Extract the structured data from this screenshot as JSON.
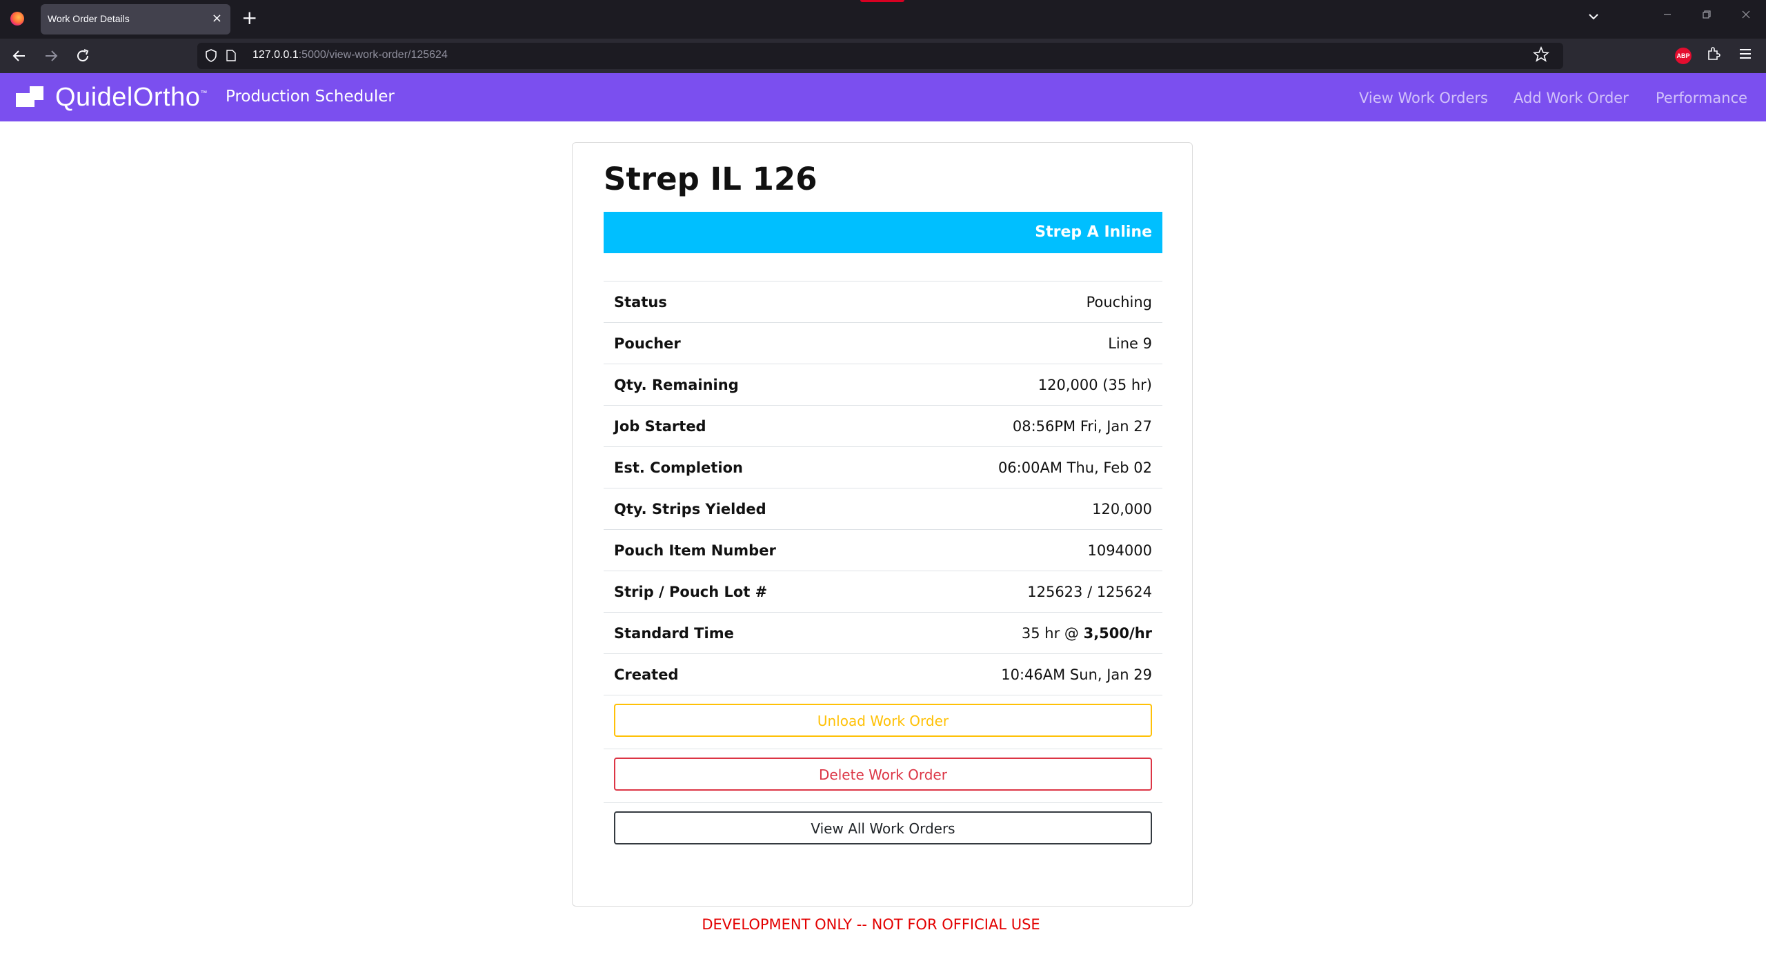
{
  "browser": {
    "tab_title": "Work Order Details",
    "tab_close": "×",
    "new_tab": "+",
    "url_host": "127.0.0.1",
    "url_path": ":5000/view-work-order/125624",
    "abp_label": "ABP"
  },
  "app": {
    "brand": "QuidelOrtho",
    "brand_tm": "™",
    "title": "Production Scheduler",
    "nav": [
      "View Work Orders",
      "Add Work Order",
      "Performance"
    ],
    "accent_color": "#7b4fef"
  },
  "work_order": {
    "title": "Strep IL 126",
    "product": "Strep A Inline",
    "product_color": "#00bfff",
    "details": [
      {
        "label": "Status",
        "value": "Pouching"
      },
      {
        "label": "Poucher",
        "value": "Line 9"
      },
      {
        "label": "Qty. Remaining",
        "value": "120,000 (35 hr)"
      },
      {
        "label": "Job Started",
        "value": "08:56PM Fri, Jan 27"
      },
      {
        "label": "Est. Completion",
        "value": "06:00AM Thu, Feb 02"
      },
      {
        "label": "Qty. Strips Yielded",
        "value": "120,000"
      },
      {
        "label": "Pouch Item Number",
        "value": "1094000"
      },
      {
        "label": "Strip / Pouch Lot #",
        "value": "125623 / 125624"
      },
      {
        "label": "Standard Time",
        "value_prefix": "35 hr @ ",
        "value_bold": "3,500/hr"
      },
      {
        "label": "Created",
        "value": "10:46AM Sun, Jan 29"
      }
    ],
    "buttons": {
      "unload": "Unload Work Order",
      "delete": "Delete Work Order",
      "view_all": "View All Work Orders"
    }
  },
  "footer": "DEVELOPMENT ONLY -- NOT FOR OFFICIAL USE"
}
